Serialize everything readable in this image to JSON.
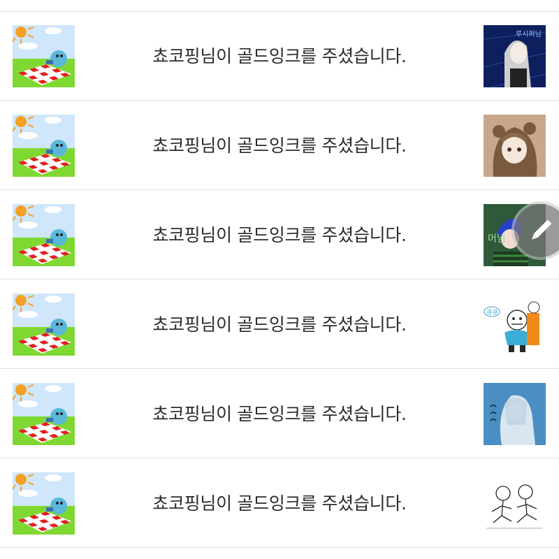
{
  "notifications": [
    {
      "message": "쵸코핑님이 골드잉크를 주셨습니다.",
      "avatar_icon": "picnic-avatar-icon",
      "thumbnail": "artwork-thumbnail-1",
      "thumb_text": "루시퍼님"
    },
    {
      "message": "쵸코핑님이 골드잉크를 주셨습니다.",
      "avatar_icon": "picnic-avatar-icon",
      "thumbnail": "artwork-thumbnail-2"
    },
    {
      "message": "쵸코핑님이 골드잉크를 주셨습니다.",
      "avatar_icon": "picnic-avatar-icon",
      "thumbnail": "artwork-thumbnail-3",
      "thumb_text": "머님"
    },
    {
      "message": "쵸코핑님이 골드잉크를 주셨습니다.",
      "avatar_icon": "picnic-avatar-icon",
      "thumbnail": "artwork-thumbnail-4",
      "thumb_text": "큐큐"
    },
    {
      "message": "쵸코핑님이 골드잉크를 주셨습니다.",
      "avatar_icon": "picnic-avatar-icon",
      "thumbnail": "artwork-thumbnail-5"
    },
    {
      "message": "쵸코핑님이 골드잉크를 주셨습니다.",
      "avatar_icon": "picnic-avatar-icon",
      "thumbnail": "artwork-thumbnail-6"
    }
  ],
  "fab": {
    "icon": "pen-icon"
  },
  "colors": {
    "divider": "#e2e2e2",
    "text": "#2b2b2b"
  }
}
